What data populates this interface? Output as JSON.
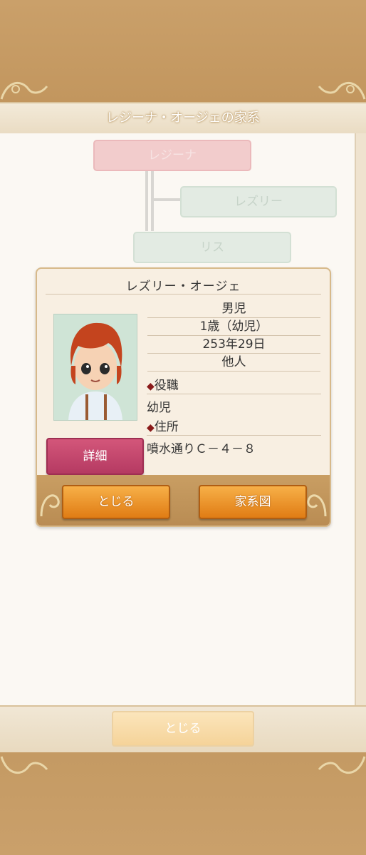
{
  "header": {
    "title": "レジーナ・オージェの家系"
  },
  "family_tree": {
    "parent": "レジーナ",
    "child": "レズリー",
    "spouse": "リス"
  },
  "popup": {
    "name": "レズリー・オージェ",
    "gender": "男児",
    "age": "1歳（幼児）",
    "birth_date": "253年29日",
    "relation": "他人",
    "occupation_label": "役職",
    "occupation_value": "幼児",
    "address_label": "住所",
    "address_value": "噴水通りＣ－４－８",
    "detail_label": "詳細",
    "close_label": "とじる",
    "family_tree_label": "家系図"
  },
  "footer": {
    "close_label": "とじる"
  },
  "colors": {
    "accent_orange": "#e07c14",
    "detail_pink": "#c3456c",
    "frame_brown": "#c79a62"
  }
}
